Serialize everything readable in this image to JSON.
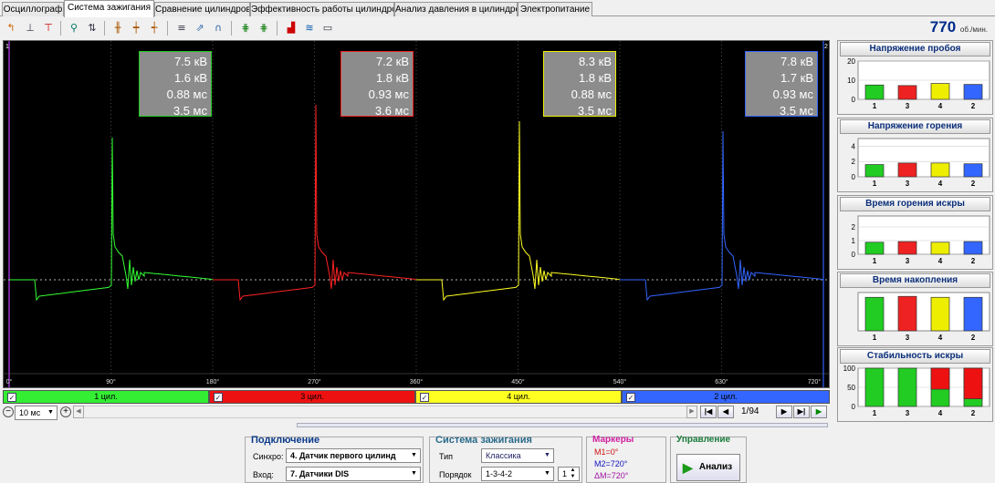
{
  "tabs": [
    {
      "label": "Осциллограф"
    },
    {
      "label": "Система зажигания"
    },
    {
      "label": "Сравнение цилиндров"
    },
    {
      "label": "Эффективность работы цилиндров"
    },
    {
      "label": "Анализ давления в цилиндре"
    },
    {
      "label": "Электропитание"
    }
  ],
  "rpm": {
    "value": "770",
    "unit": "об./мин."
  },
  "scope": {
    "markers": {
      "left": "1",
      "right": "2"
    },
    "angle_ticks": [
      "0°",
      "90°",
      "180°",
      "270°",
      "360°",
      "450°",
      "540°",
      "630°",
      "720°"
    ],
    "info_boxes": [
      {
        "l1": "7.5 кВ",
        "l2": "1.6 кВ",
        "l3": "0.88 мс",
        "l4": "3.5 мс",
        "color": "#22cc22"
      },
      {
        "l1": "7.2 кВ",
        "l2": "1.8 кВ",
        "l3": "0.93 мс",
        "l4": "3.6 мс",
        "color": "#ee2222"
      },
      {
        "l1": "8.3 кВ",
        "l2": "1.8 кВ",
        "l3": "0.88 мс",
        "l4": "3.5 мс",
        "color": "#eeee00"
      },
      {
        "l1": "7.8 кВ",
        "l2": "1.7 кВ",
        "l3": "0.93 мс",
        "l4": "3.5 мс",
        "color": "#3366ff"
      }
    ]
  },
  "cylinders": [
    {
      "label": "1 цил.",
      "color": "#33ee33",
      "check": "✓"
    },
    {
      "label": "3 цил.",
      "color": "#ee1111",
      "check": "✓"
    },
    {
      "label": "4 цил.",
      "color": "#ffff22",
      "check": "✓"
    },
    {
      "label": "2 цил.",
      "color": "#3366ff",
      "check": "✓"
    }
  ],
  "nav": {
    "timebase": "10 мс",
    "page": "1/94"
  },
  "panels": {
    "connection": {
      "title": "Подключение",
      "sync_label": "Синхро:",
      "sync_value": "4.  Датчик первого цилинд",
      "input_label": "Вход:",
      "input_value": "7.  Датчики DIS"
    },
    "ignition": {
      "title": "Система зажигания",
      "type_label": "Тип",
      "type_value": "Классика",
      "order_label": "Порядок",
      "order_value": "1-3-4-2",
      "order_num": "1"
    },
    "markers": {
      "title": "Маркеры",
      "m1": "M1=0°",
      "m2": "M2=720°",
      "dm": "ΔM=720°"
    },
    "control": {
      "title": "Управление",
      "analyze_label": "Анализ"
    }
  },
  "chart_data": [
    {
      "type": "bar",
      "title": "Напряжение пробоя",
      "categories": [
        "1",
        "3",
        "4",
        "2"
      ],
      "values": [
        7.5,
        7.2,
        8.3,
        7.8
      ],
      "ylim": [
        0,
        20
      ],
      "yticks": [
        "20",
        "10",
        "0"
      ],
      "colors": [
        "#22cc22",
        "#ee2222",
        "#eeee00",
        "#3366ff"
      ]
    },
    {
      "type": "bar",
      "title": "Напряжение горения",
      "categories": [
        "1",
        "3",
        "4",
        "2"
      ],
      "values": [
        1.6,
        1.8,
        1.8,
        1.7
      ],
      "ylim": [
        0,
        5
      ],
      "yticks": [
        "4",
        "2",
        "0"
      ],
      "colors": [
        "#22cc22",
        "#ee2222",
        "#eeee00",
        "#3366ff"
      ]
    },
    {
      "type": "bar",
      "title": "Время горения искры",
      "categories": [
        "1",
        "3",
        "4",
        "2"
      ],
      "values": [
        0.88,
        0.93,
        0.88,
        0.93
      ],
      "ylim": [
        0,
        2.8
      ],
      "yticks": [
        "2",
        "1",
        "0"
      ],
      "colors": [
        "#22cc22",
        "#ee2222",
        "#eeee00",
        "#3366ff"
      ]
    },
    {
      "type": "bar",
      "title": "Время накопления",
      "categories": [
        "1",
        "3",
        "4",
        "2"
      ],
      "values": [
        3.5,
        3.6,
        3.5,
        3.5
      ],
      "ylim": [
        0,
        4
      ],
      "yticks": [],
      "colors": [
        "#22cc22",
        "#ee2222",
        "#eeee00",
        "#3366ff"
      ]
    },
    {
      "type": "bar",
      "title": "Стабильность искры",
      "categories": [
        "1",
        "3",
        "4",
        "2"
      ],
      "values": [
        100,
        100,
        100,
        100
      ],
      "unstable": [
        0,
        0,
        45,
        20
      ],
      "ylim": [
        0,
        100
      ],
      "yticks": [
        "100",
        "50",
        "0"
      ],
      "colors": [
        "#22cc22",
        "#22cc22",
        "#22cc22",
        "#22cc22"
      ]
    }
  ]
}
